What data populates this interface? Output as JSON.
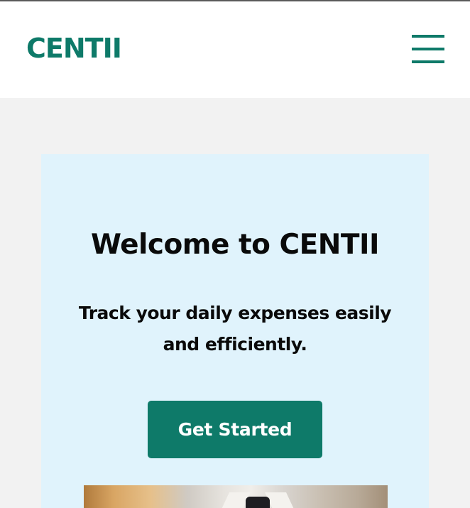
{
  "header": {
    "logo_text": "CENTII",
    "menu_icon": "hamburger-menu-icon"
  },
  "hero": {
    "title": "Welcome to CENTII",
    "subtitle": "Track your daily expenses easily and efficiently.",
    "cta_label": "Get Started"
  },
  "colors": {
    "brand": "#0e7a69",
    "hero_background": "#e0f3fc",
    "page_background": "#f2f2f2",
    "header_background": "#ffffff"
  }
}
